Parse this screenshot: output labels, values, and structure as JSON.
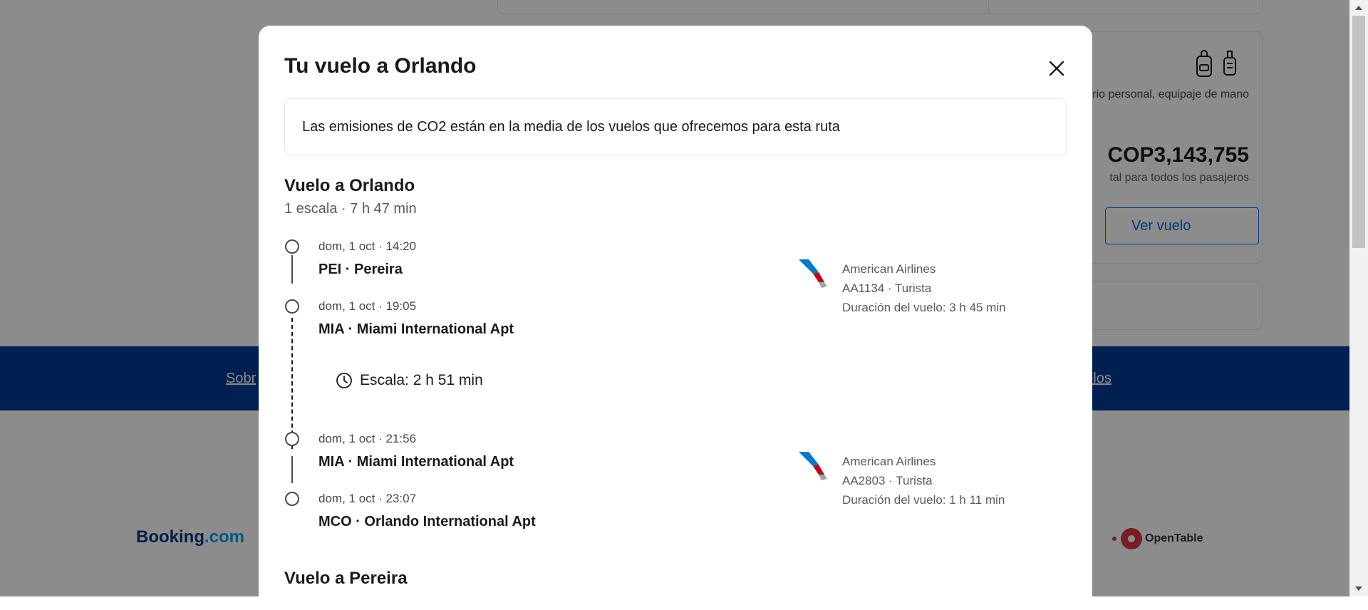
{
  "background": {
    "fare_card": {
      "baggage_text": "orio personal, equipaje de mano",
      "price": "COP3,143,755",
      "price_note": "tal para todos los pasajeros",
      "view_button": "Ver vuelo"
    },
    "footer": {
      "left_link": "Sobr",
      "right_link": "uelos"
    },
    "partner_logos": {
      "booking": "Booking",
      "booking_domain": ".com",
      "opentable": "OpenTable"
    }
  },
  "modal": {
    "title": "Tu vuelo a Orlando",
    "co2_note": "Las emisiones de CO2 están en la media de los vuelos que ofrecemos para esta ruta",
    "outbound": {
      "title": "Vuelo a Orlando",
      "summary": "1 escala · 7 h 47 min",
      "segments": [
        {
          "depart_time": "dom, 1 oct · 14:20",
          "depart_airport": "PEI · Pereira",
          "arrive_time": "dom, 1 oct · 19:05",
          "arrive_airport": "MIA · Miami International Apt",
          "airline": "American Airlines",
          "flight": "AA1134 · Turista",
          "duration": "Duración del vuelo: 3 h 45 min"
        },
        {
          "depart_time": "dom, 1 oct · 21:56",
          "depart_airport": "MIA · Miami International Apt",
          "arrive_time": "dom, 1 oct · 23:07",
          "arrive_airport": "MCO · Orlando International Apt",
          "airline": "American Airlines",
          "flight": "AA2803 · Turista",
          "duration": "Duración del vuelo: 1 h 11 min"
        }
      ],
      "layover": "Escala: 2 h 51 min"
    },
    "return": {
      "title": "Vuelo a Pereira"
    }
  },
  "icons": {
    "close": "close-icon",
    "clock": "clock-icon",
    "airline": "american-airlines-logo",
    "backpack": "backpack-icon",
    "suitcase": "suitcase-icon"
  },
  "colors": {
    "brand_blue": "#003b95",
    "link_blue": "#006ce4",
    "overlay": "rgba(0,0,0,0.45)"
  }
}
